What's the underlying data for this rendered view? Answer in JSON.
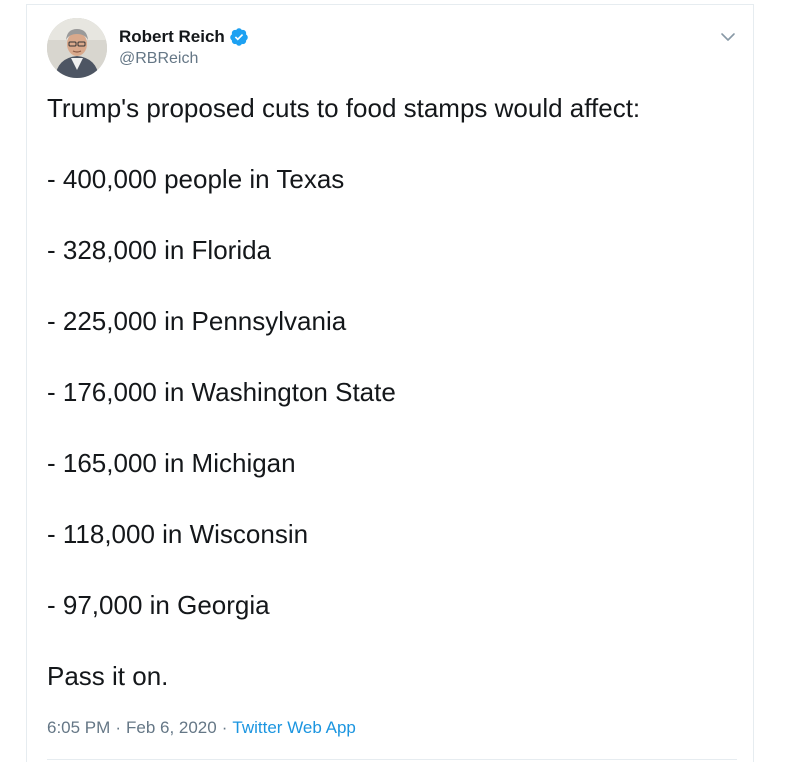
{
  "author": {
    "name": "Robert Reich",
    "handle": "@RBReich",
    "verified": true,
    "verified_color": "#1da1f2",
    "avatar_icon": "avatar-photo"
  },
  "tweet": {
    "lines": [
      "Trump's proposed cuts to food stamps would affect:",
      "- 400,000 people in Texas",
      "- 328,000 in Florida",
      "- 225,000 in Pennsylvania",
      "- 176,000 in Washington State",
      "- 165,000 in Michigan",
      "- 118,000 in Wisconsin",
      "- 97,000 in Georgia",
      "Pass it on."
    ]
  },
  "meta": {
    "time": "6:05 PM",
    "separator": "·",
    "date": "Feb 6, 2020",
    "app": "Twitter Web App"
  },
  "colors": {
    "text": "#14171a",
    "secondary": "#657786",
    "link": "#1b95e0",
    "border": "#e6ecf0"
  },
  "icons": {
    "more": "chevron-down-icon",
    "verified": "verified-badge-icon"
  }
}
